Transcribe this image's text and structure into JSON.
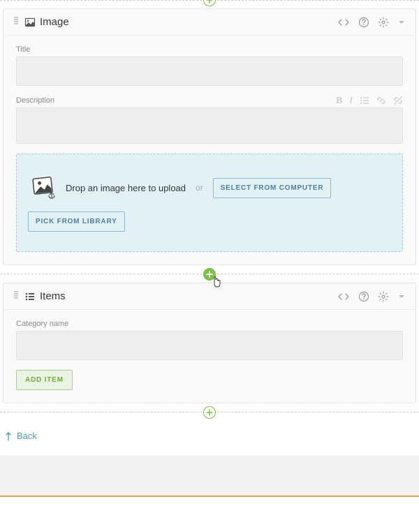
{
  "image_panel": {
    "title": "Image",
    "fields": {
      "title_label": "Title",
      "description_label": "Description"
    },
    "dropzone": {
      "hint": "Drop an image here to upload",
      "or": "or",
      "select_computer": "SELECT FROM COMPUTER",
      "pick_library": "PICK FROM LIBRARY"
    }
  },
  "items_panel": {
    "title": "Items",
    "category_label": "Category name",
    "add_item_label": "ADD ITEM"
  },
  "back_label": "Back"
}
